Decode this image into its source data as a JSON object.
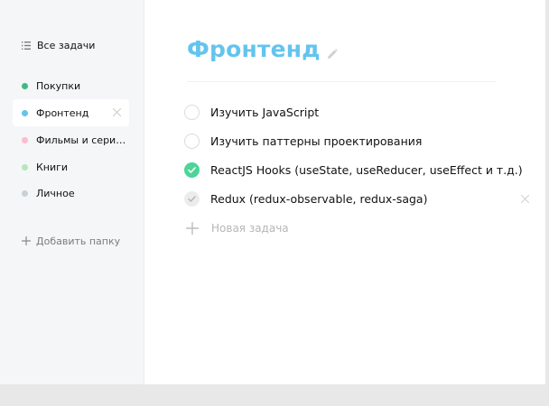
{
  "sidebar": {
    "all_tasks_label": "Все задачи",
    "folders": [
      {
        "label": "Покупки",
        "color": "#42b883"
      },
      {
        "label": "Фронтенд",
        "color": "#64c4ed"
      },
      {
        "label": "Фильмы и сериа...",
        "color": "#ffbbcc"
      },
      {
        "label": "Книги",
        "color": "#b6e6bd"
      },
      {
        "label": "Личное",
        "color": "#c9d1d3"
      }
    ],
    "active_folder": "Фронтенд",
    "add_folder_label": "Добавить папку"
  },
  "main": {
    "title": "Фронтенд",
    "title_color": "#64c4ed",
    "tasks": [
      {
        "text": "Изучить JavaScript",
        "state": "unchecked"
      },
      {
        "text": "Изучить паттерны проектирования",
        "state": "unchecked"
      },
      {
        "text": "ReactJS Hooks (useState, useReducer, useEffect и т.д.)",
        "state": "checked"
      },
      {
        "text": "Redux (redux-observable, redux-saga)",
        "state": "hovered"
      }
    ],
    "new_task_placeholder": "Новая задача",
    "check_color": "#4dd599"
  }
}
